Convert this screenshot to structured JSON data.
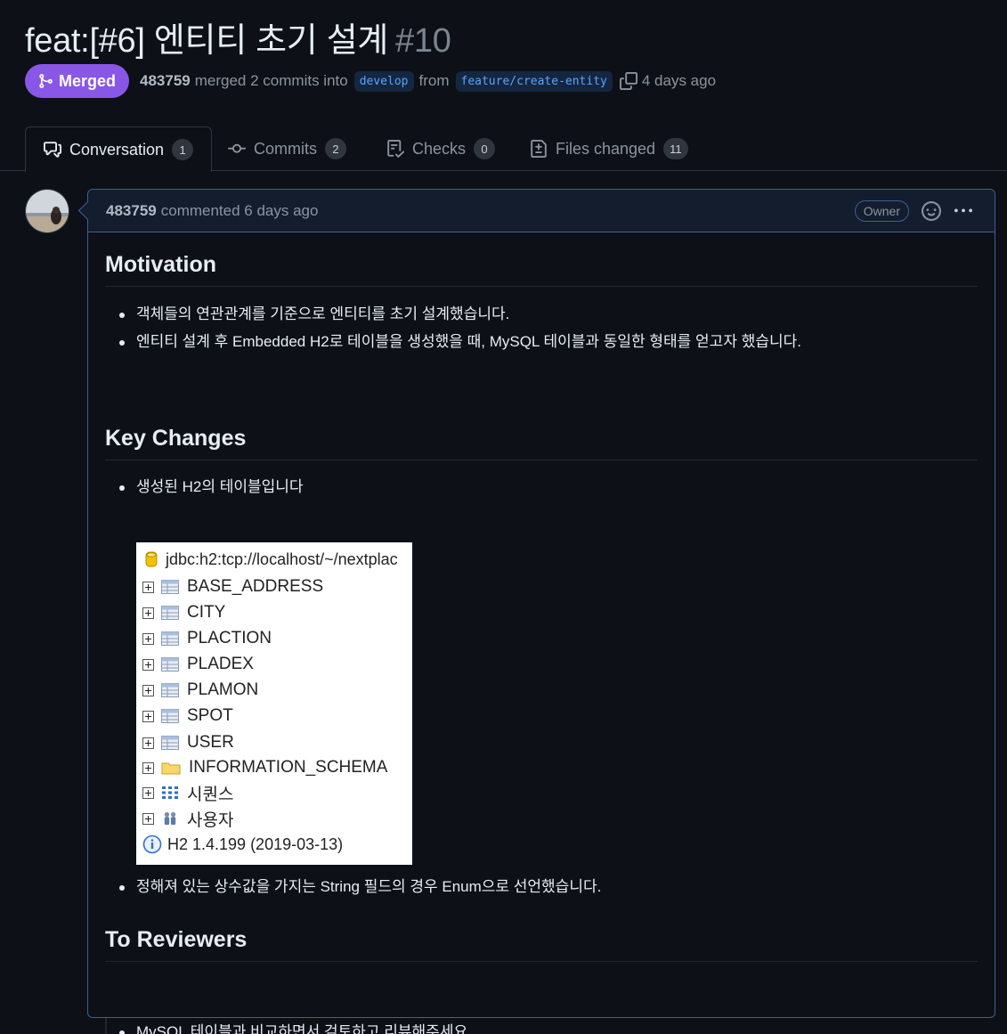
{
  "pr": {
    "title": "feat:[#6] 엔티티 초기 설계",
    "number": "#10",
    "state": "Merged",
    "author": "483759",
    "merged_text": "merged 2 commits into",
    "base_branch": "develop",
    "from_text": "from",
    "head_branch": "feature/create-entity",
    "time": "4 days ago"
  },
  "tabs": [
    {
      "label": "Conversation",
      "count": "1",
      "icon": "comment-discussion-icon"
    },
    {
      "label": "Commits",
      "count": "2",
      "icon": "git-commit-icon"
    },
    {
      "label": "Checks",
      "count": "0",
      "icon": "checklist-icon"
    },
    {
      "label": "Files changed",
      "count": "11",
      "icon": "file-diff-icon"
    }
  ],
  "comment": {
    "author": "483759",
    "action": "commented 6 days ago",
    "role_badge": "Owner",
    "sections": {
      "motivation": {
        "heading": "Motivation",
        "items": [
          "객체들의 연관관계를 기준으로 엔티티를 초기 설계했습니다.",
          "엔티티 설계 후 Embedded H2로 테이블을 생성했을 때, MySQL 테이블과 동일한 형태를 얻고자 했습니다."
        ]
      },
      "key_changes": {
        "heading": "Key Changes",
        "items": [
          "생성된 H2의 테이블입니다",
          "정해져 있는 상수값을 가지는 String 필드의 경우 Enum으로 선언했습니다."
        ]
      },
      "to_reviewers": {
        "heading": "To Reviewers",
        "items": [
          "MySQL 테이블과 비교하면서 검토하고 리뷰해주세요"
        ]
      }
    },
    "db_tree": {
      "connection": "jdbc:h2:tcp://localhost/~/nextplac",
      "tables": [
        "BASE_ADDRESS",
        "CITY",
        "PLACTION",
        "PLADEX",
        "PLAMON",
        "SPOT",
        "USER"
      ],
      "schema": "INFORMATION_SCHEMA",
      "sequences": "시퀀스",
      "users": "사용자",
      "version": "H2 1.4.199 (2019-03-13)"
    }
  },
  "colors": {
    "background": "#0d1117",
    "merged": "#8957e5",
    "link": "#58a6ff",
    "border_highlight": "#3f5e94"
  }
}
